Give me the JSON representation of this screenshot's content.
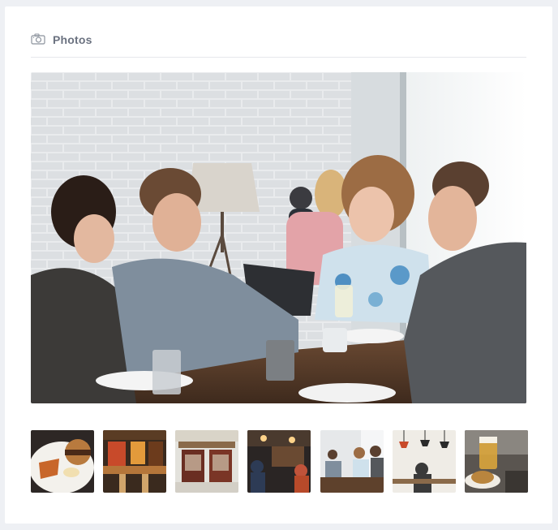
{
  "header": {
    "icon": "camera-icon",
    "title": "Photos"
  },
  "main_photo": {
    "subject": "restaurant-friends-photo"
  },
  "thumbnails": [
    {
      "subject": "burger-fries-plate"
    },
    {
      "subject": "bar-interior"
    },
    {
      "subject": "restaurant-storefront"
    },
    {
      "subject": "busy-restaurant-night"
    },
    {
      "subject": "friends-at-table"
    },
    {
      "subject": "dining-room-lamps"
    },
    {
      "subject": "beer-and-bread"
    }
  ],
  "colors": {
    "page_bg": "#eef0f4",
    "card_bg": "#ffffff",
    "title": "#6b7280",
    "divider": "#e6e8ec"
  }
}
